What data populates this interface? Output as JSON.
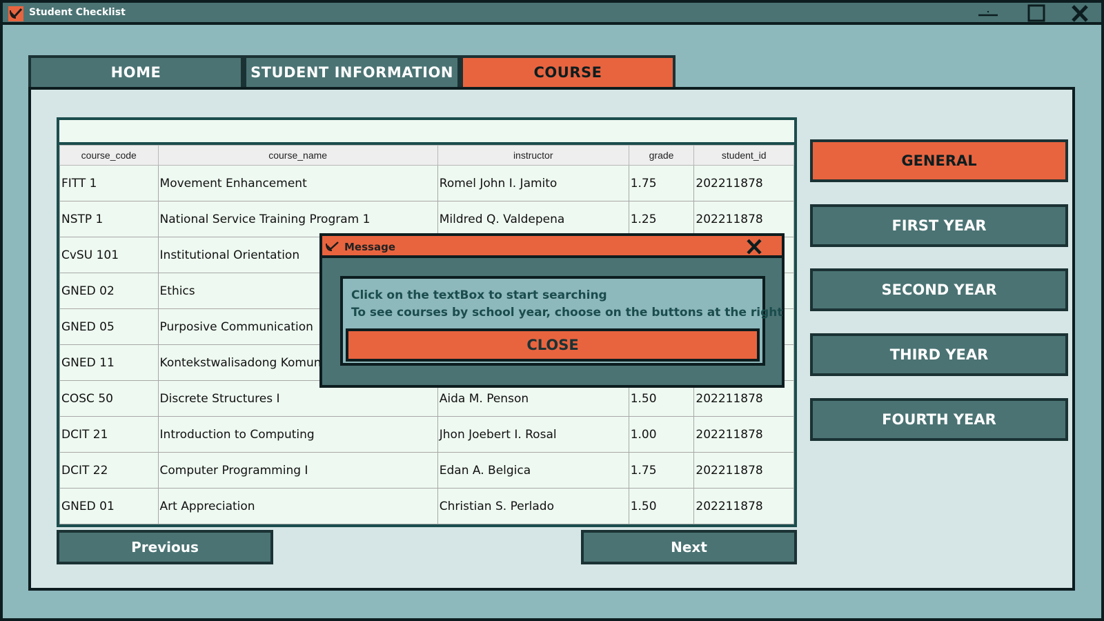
{
  "window": {
    "title": "Student Checklist"
  },
  "tabs": [
    {
      "label": "HOME"
    },
    {
      "label": "STUDENT INFORMATION"
    },
    {
      "label": "COURSE",
      "active": true
    }
  ],
  "search": {
    "value": ""
  },
  "table": {
    "columns": [
      "course_code",
      "course_name",
      "instructor",
      "grade",
      "student_id"
    ],
    "rows": [
      [
        "FITT 1",
        "Movement Enhancement",
        "Romel John I. Jamito",
        "1.75",
        "202211878"
      ],
      [
        "NSTP 1",
        "National Service Training Program 1",
        "Mildred Q. Valdepena",
        "1.25",
        "202211878"
      ],
      [
        "CvSU 101",
        "Institutional Orientation",
        "",
        "",
        ""
      ],
      [
        "GNED 02",
        "Ethics",
        "",
        "",
        ""
      ],
      [
        "GNED 05",
        "Purposive Communication",
        "",
        "",
        ""
      ],
      [
        "GNED 11",
        "Kontekstwalisadong Komunik",
        "",
        "",
        ""
      ],
      [
        "COSC 50",
        "Discrete Structures I",
        "Aida M. Penson",
        "1.50",
        "202211878"
      ],
      [
        "DCIT 21",
        "Introduction to Computing",
        "Jhon Joebert I. Rosal",
        "1.00",
        "202211878"
      ],
      [
        "DCIT 22",
        "Computer Programming I",
        "Edan A. Belgica",
        "1.75",
        "202211878"
      ],
      [
        "GNED 01",
        "Art Appreciation",
        "Christian S. Perlado",
        "1.50",
        "202211878"
      ]
    ]
  },
  "nav": {
    "previous": "Previous",
    "next": "Next"
  },
  "year_buttons": {
    "general": "GENERAL",
    "first": "FIRST YEAR",
    "second": "SECOND YEAR",
    "third": "THIRD YEAR",
    "fourth": "FOURTH YEAR"
  },
  "dialog": {
    "title": "Message",
    "line1": "Click on the textBox to start searching",
    "line2": "To see courses by school year, choose on the buttons at the right",
    "close": "CLOSE"
  },
  "colors": {
    "accent": "#e8643f",
    "teal": "#4b7373",
    "background": "#8db8bc",
    "panel": "#d6e5e5",
    "table_bg": "#eef9f1"
  },
  "icons": {
    "app": "checkmark-icon",
    "minimize": "minimize-icon",
    "maximize": "maximize-icon",
    "close": "close-icon"
  }
}
